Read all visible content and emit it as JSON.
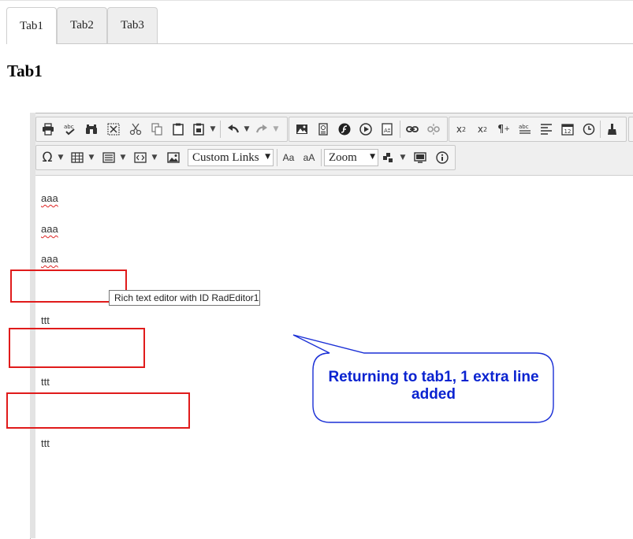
{
  "tabs": [
    {
      "label": "Tab1",
      "active": true
    },
    {
      "label": "Tab2",
      "active": false
    },
    {
      "label": "Tab3",
      "active": false
    }
  ],
  "page_title": "Tab1",
  "toolbar": {
    "row1_icons": [
      "print-icon",
      "spellcheck-icon",
      "find-icon",
      "select-all-icon",
      "cut-icon",
      "copy-icon",
      "paste-icon",
      "paste-options-icon",
      "undo-icon",
      "redo-icon",
      "image-manager-icon",
      "document-manager-icon",
      "flash-manager-icon",
      "media-manager-icon",
      "template-manager-icon",
      "link-icon",
      "unlink-icon",
      "superscript-icon",
      "subscript-icon",
      "paragraph-icon",
      "spell-abc-icon",
      "align-icon",
      "date-icon",
      "time-icon",
      "format-stripper-icon"
    ],
    "row2_icons": [
      "symbol-icon",
      "table-icon",
      "paragraph-style-icon",
      "snippet-icon",
      "image-icon",
      "case-lower-icon",
      "case-upper-icon",
      "module-icon",
      "preview-icon",
      "about-icon"
    ],
    "custom_links_label": "Custom Links",
    "zoom_label": "Zoom",
    "case_lower_label": "Aa",
    "case_upper_label": "aA"
  },
  "content": {
    "lines": [
      "aaa",
      "aaa",
      "aaa",
      "ttt",
      "ttt",
      "ttt"
    ]
  },
  "tooltip": "Rich text editor with ID RadEditor1",
  "callout": {
    "text": "Returning to tab1, 1 extra line added",
    "color": "#0a23d0"
  },
  "colors": {
    "highlight_box": "#e01b1b"
  }
}
